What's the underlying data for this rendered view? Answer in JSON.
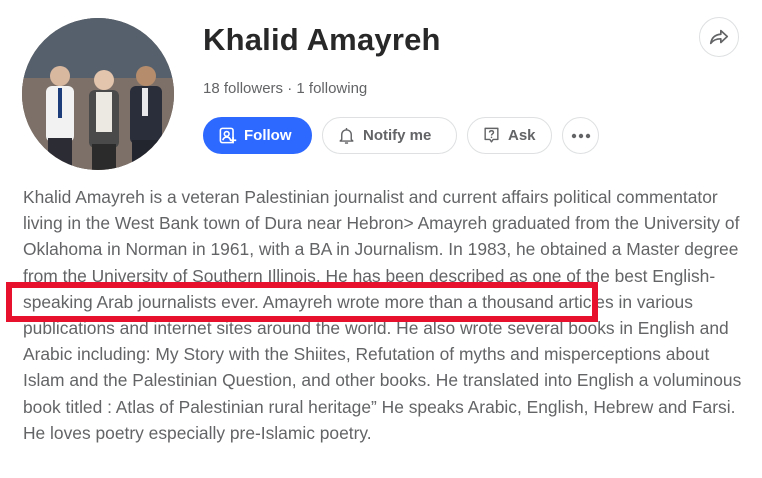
{
  "profile": {
    "name": "Khalid Amayreh",
    "followers": "18 followers",
    "separator": " · ",
    "following": "1 following",
    "avatar_icon": "profile-photo"
  },
  "actions": {
    "follow_label": "Follow",
    "notify_label": "Notify me",
    "ask_label": "Ask"
  },
  "colors": {
    "accent": "#2e69ff",
    "highlight": "#e8112d",
    "text_secondary": "#636466"
  },
  "bio": {
    "text": "Khalid Amayreh is a veteran Palestinian journalist and current affairs political commentator living in the West Bank town of Dura near Hebron> Amayreh graduated from the University of Oklahoma in Norman in 1961, with a BA in Journalism. In 1983, he obtained a Master degree from the University of Southern Illinois. He has been described as one of the best English-speaking Arab journalists ever. Amayreh wrote more than a thousand articles in various publications and internet sites around the world. He also wrote several books in English and Arabic including: My Story with the Shiites, Refutation of myths and misperceptions about Islam and the Palestinian Question, and other books. He translated into English a voluminous book titled : Atlas of Palestinian rural heritage” He speaks Arabic, English, Hebrew and Farsi. He loves poetry especially pre-Islamic poetry."
  }
}
